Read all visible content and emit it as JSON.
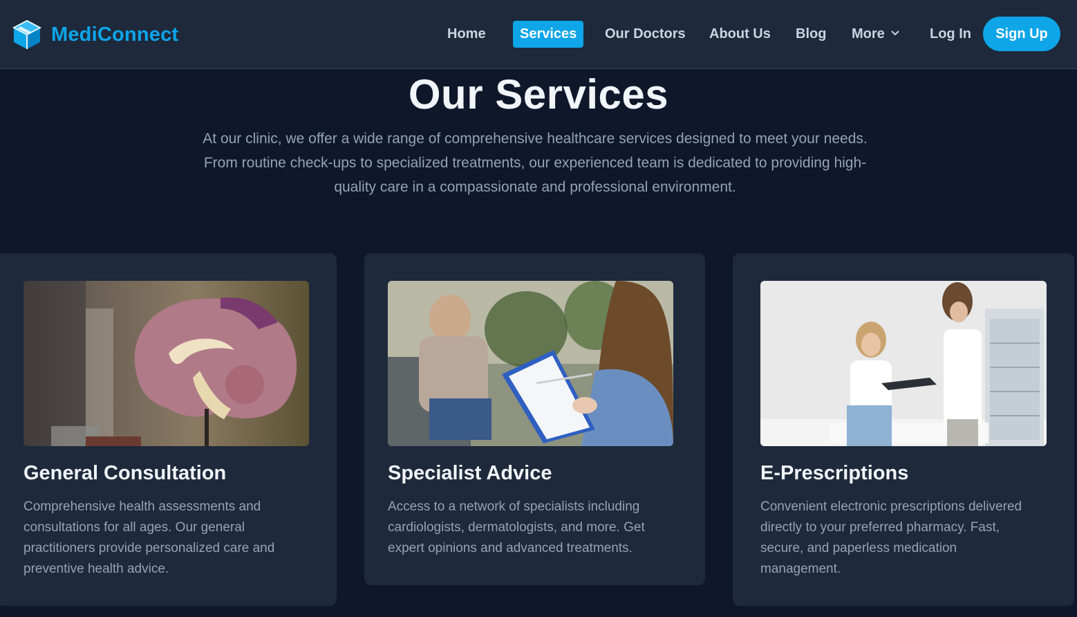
{
  "brand": {
    "name": "MediConnect",
    "icon": "cube-logo-icon",
    "color": "#0ea5e9"
  },
  "nav": {
    "items": [
      {
        "label": "Home",
        "active": false
      },
      {
        "label": "Services",
        "active": true
      },
      {
        "label": "Our Doctors",
        "active": false
      },
      {
        "label": "About Us",
        "active": false
      },
      {
        "label": "Blog",
        "active": false
      },
      {
        "label": "More",
        "active": false,
        "icon": "chevron-down-icon"
      }
    ],
    "login_label": "Log In",
    "signup_label": "Sign Up"
  },
  "hero": {
    "title": "Our Services",
    "description": "At our clinic, we offer a wide range of comprehensive healthcare services designed to meet your needs. From routine check-ups to specialized treatments, our experienced team is dedicated to providing high-quality care in a compassionate and professional environment."
  },
  "services": [
    {
      "title": "General Consultation",
      "description": "Comprehensive health assessments and consultations for all ages. Our general practitioners provide personalized care and preventive health advice."
    },
    {
      "title": "Specialist Advice",
      "description": "Access to a network of specialists including cardiologists, dermatologists, and more. Get expert opinions and advanced treatments."
    },
    {
      "title": "E-Prescriptions",
      "description": "Convenient electronic prescriptions delivered directly to your preferred pharmacy. Fast, secure, and paperless medication management."
    }
  ],
  "colors": {
    "background": "#0f172a",
    "surface": "#1e293b",
    "accent": "#0ea5e9",
    "muted_text": "#94a3b8"
  }
}
